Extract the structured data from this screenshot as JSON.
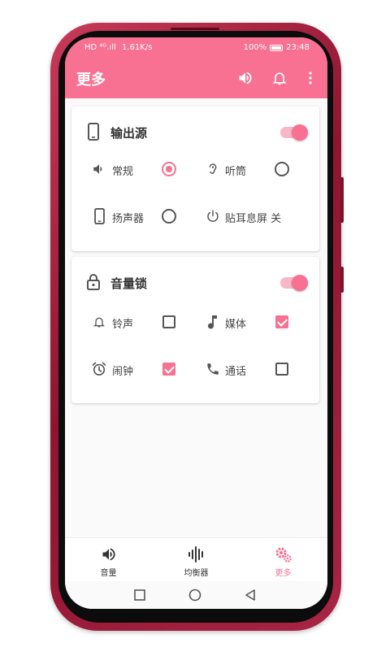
{
  "status_bar": {
    "signal": "HD ⁴ᴳ.ıll",
    "speed": "1.61K/s",
    "battery": "100%",
    "time": "23:48"
  },
  "app": {
    "title": "更多",
    "accent": "#f87192",
    "toolbar_icons": [
      "volume-icon",
      "bell-icon",
      "more-vert-icon"
    ]
  },
  "output_source": {
    "title": "输出源",
    "toggle_on": true,
    "options": [
      {
        "label": "常规",
        "icon": "volume-icon",
        "control": "radio",
        "checked": true
      },
      {
        "label": "听筒",
        "icon": "ear-icon",
        "control": "radio",
        "checked": false
      },
      {
        "label": "扬声器",
        "icon": "phone-icon",
        "control": "radio",
        "checked": false
      },
      {
        "label": "贴耳息屏 关",
        "icon": "power-icon",
        "control": "none"
      }
    ]
  },
  "volume_lock": {
    "title": "音量锁",
    "toggle_on": true,
    "options": [
      {
        "label": "铃声",
        "icon": "bell-icon",
        "control": "checkbox",
        "checked": false
      },
      {
        "label": "媒体",
        "icon": "music-note-icon",
        "control": "checkbox",
        "checked": true
      },
      {
        "label": "闹钟",
        "icon": "alarm-icon",
        "control": "checkbox",
        "checked": true
      },
      {
        "label": "通话",
        "icon": "call-icon",
        "control": "checkbox",
        "checked": false
      }
    ]
  },
  "bottom_nav": [
    {
      "label": "音量",
      "icon": "volume-icon",
      "active": false
    },
    {
      "label": "均衡器",
      "icon": "equalizer-icon",
      "active": false
    },
    {
      "label": "更多",
      "icon": "gears-icon",
      "active": true
    }
  ]
}
